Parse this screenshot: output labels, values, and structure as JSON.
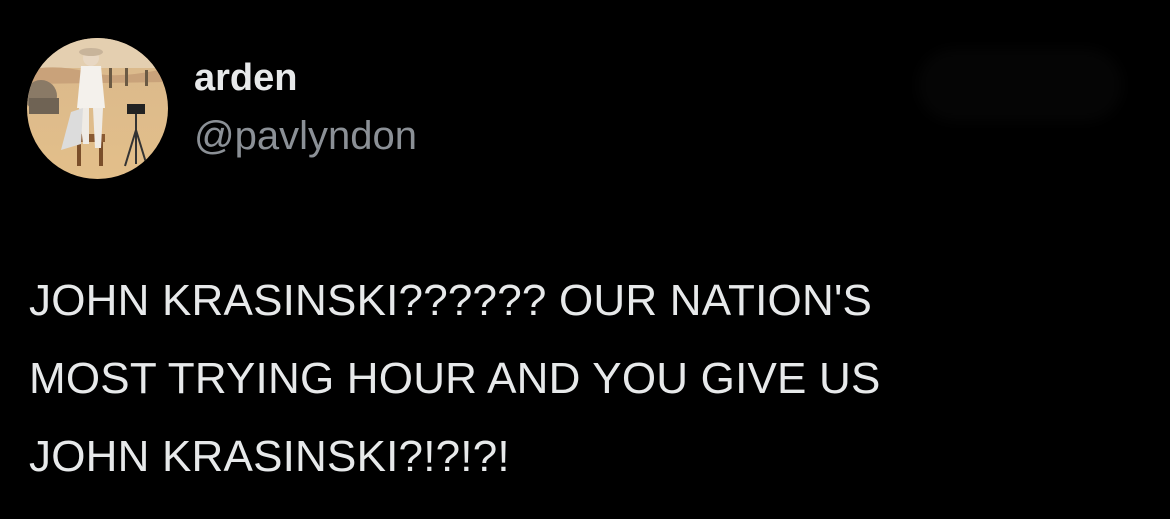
{
  "tweet": {
    "author": {
      "display_name": "arden",
      "handle": "@pavlyndon",
      "avatar": "profile-photo"
    },
    "text_lines": [
      "JOHN KRASINSKI?????? OUR NATION'S",
      "MOST TRYING HOUR AND YOU GIVE US",
      "JOHN KRASINSKI?!?!?!"
    ]
  },
  "colors": {
    "background": "#000000",
    "primary_text": "#e7e9ea",
    "secondary_text": "#8b9096"
  }
}
